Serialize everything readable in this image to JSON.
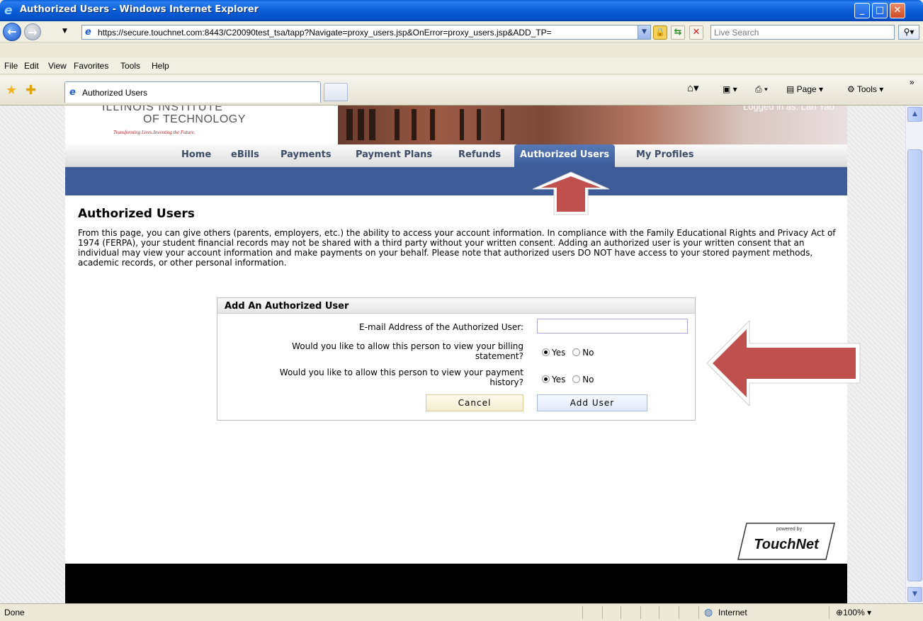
{
  "window": {
    "title": "Authorized Users - Windows Internet Explorer",
    "minimize": "_",
    "maximize": "□",
    "close": "✕"
  },
  "address": {
    "url": "https://secure.touchnet.com:8443/C20090test_tsa/tapp?Navigate=proxy_users.jsp&OnError=proxy_users.jsp&ADD_TP=",
    "search_placeholder": "Live Search"
  },
  "menu": [
    "File",
    "Edit",
    "View",
    "Favorites",
    "Tools",
    "Help"
  ],
  "browser_tab": {
    "label": "Authorized Users"
  },
  "command_bar": {
    "page": "Page",
    "tools": "Tools",
    "more": "»"
  },
  "site": {
    "logo_line1": "ILLINOIS INSTITUTE",
    "logo_line2": "OF TECHNOLOGY",
    "tagline": "Transforming Lives.Inventing the Future.",
    "logged_in": "Logged in as: Lan Yao"
  },
  "nav": {
    "home": "Home",
    "ebills": "eBills",
    "payments": "Payments",
    "payment_plans": "Payment Plans",
    "refunds": "Refunds",
    "authorized_users": "Authorized Users",
    "my_profiles": "My Profiles"
  },
  "main": {
    "title": "Authorized Users",
    "intro": "From this page, you can give others (parents, employers, etc.) the ability to access your account information. In compliance with the Family Educational Rights and Privacy Act of 1974 (FERPA), your student financial records may not be shared with a third party without your written consent. Adding an authorized user is your written consent that an individual may view your account information and make payments on your behalf. Please note that authorized users DO NOT have access to your stored payment methods, academic records, or other personal information."
  },
  "form": {
    "heading": "Add An Authorized User",
    "email_label": "E-mail Address of the Authorized User:",
    "email_value": "",
    "billing_label_1": "Would you like to allow this person to view your billing",
    "billing_label_2": "statement?",
    "history_label_1": "Would you like to allow this person to view your payment",
    "history_label_2": "history?",
    "yes": "Yes",
    "no": "No",
    "cancel": "Cancel",
    "add_user": "Add User"
  },
  "footer_logo": {
    "powered_by": "powered by",
    "brand": "TouchNet"
  },
  "status": {
    "text": "Done",
    "zone": "Internet",
    "zoom": "100%"
  },
  "colors": {
    "nav_active": "#3c5a99",
    "blue_band": "#3e5c98",
    "arrow_red": "#c0504d"
  }
}
